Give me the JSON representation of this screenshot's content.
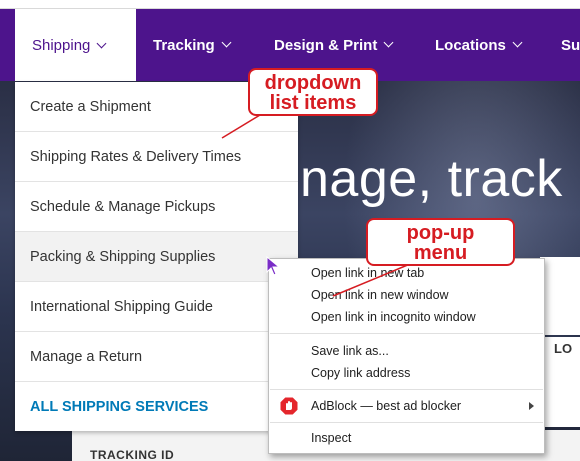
{
  "navbar": {
    "items": [
      {
        "label": "Shipping"
      },
      {
        "label": "Tracking"
      },
      {
        "label": "Design & Print"
      },
      {
        "label": "Locations"
      },
      {
        "label": "Su"
      }
    ]
  },
  "hero": {
    "headline": "nage, track",
    "card_label": "TRACKING ID",
    "side_label": "LO"
  },
  "dropdown": {
    "items": [
      {
        "label": "Create a Shipment"
      },
      {
        "label": "Shipping Rates & Delivery Times"
      },
      {
        "label": "Schedule & Manage Pickups"
      },
      {
        "label": "Packing & Shipping Supplies"
      },
      {
        "label": "International Shipping Guide"
      },
      {
        "label": "Manage a Return"
      },
      {
        "label": "ALL SHIPPING SERVICES"
      }
    ]
  },
  "context_menu": {
    "items": [
      {
        "label": "Open link in new tab"
      },
      {
        "label": "Open link in new window"
      },
      {
        "label": "Open link in incognito window"
      },
      {
        "label": "Save link as..."
      },
      {
        "label": "Copy link address"
      },
      {
        "label": "AdBlock — best ad blocker"
      },
      {
        "label": "Inspect"
      }
    ],
    "adblock_icon": "adblock-hand-icon"
  },
  "annotations": {
    "dropdown_callout": {
      "line1": "dropdown",
      "line2": "list items"
    },
    "popup_callout": {
      "line1": "pop-up",
      "line2": "menu"
    }
  },
  "colors": {
    "brand_purple": "#4d148c",
    "link_blue": "#007ab7",
    "annotation_red": "#d61c22"
  }
}
